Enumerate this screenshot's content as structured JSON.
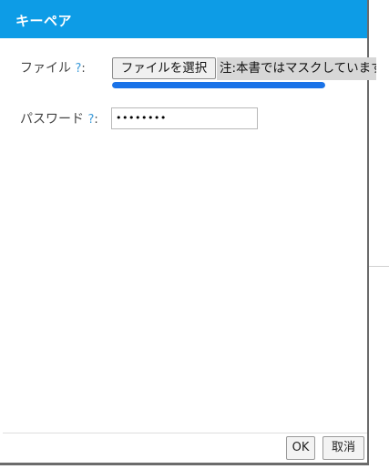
{
  "dialog": {
    "title": "キーペア"
  },
  "form": {
    "file": {
      "label": "ファイル",
      "help": "?",
      "colon": ":",
      "button_label": "ファイルを選択",
      "note": "注:本書ではマスクしています",
      "upload_progress": 1.0
    },
    "password": {
      "label": "パスワード",
      "help": "?",
      "colon": ":",
      "value": "••••••••"
    }
  },
  "footer": {
    "ok_label": "OK",
    "cancel_label": "取消"
  },
  "colors": {
    "titlebar": "#0d9ce6",
    "progress": "#1a73e8",
    "help": "#3a9ad9"
  }
}
